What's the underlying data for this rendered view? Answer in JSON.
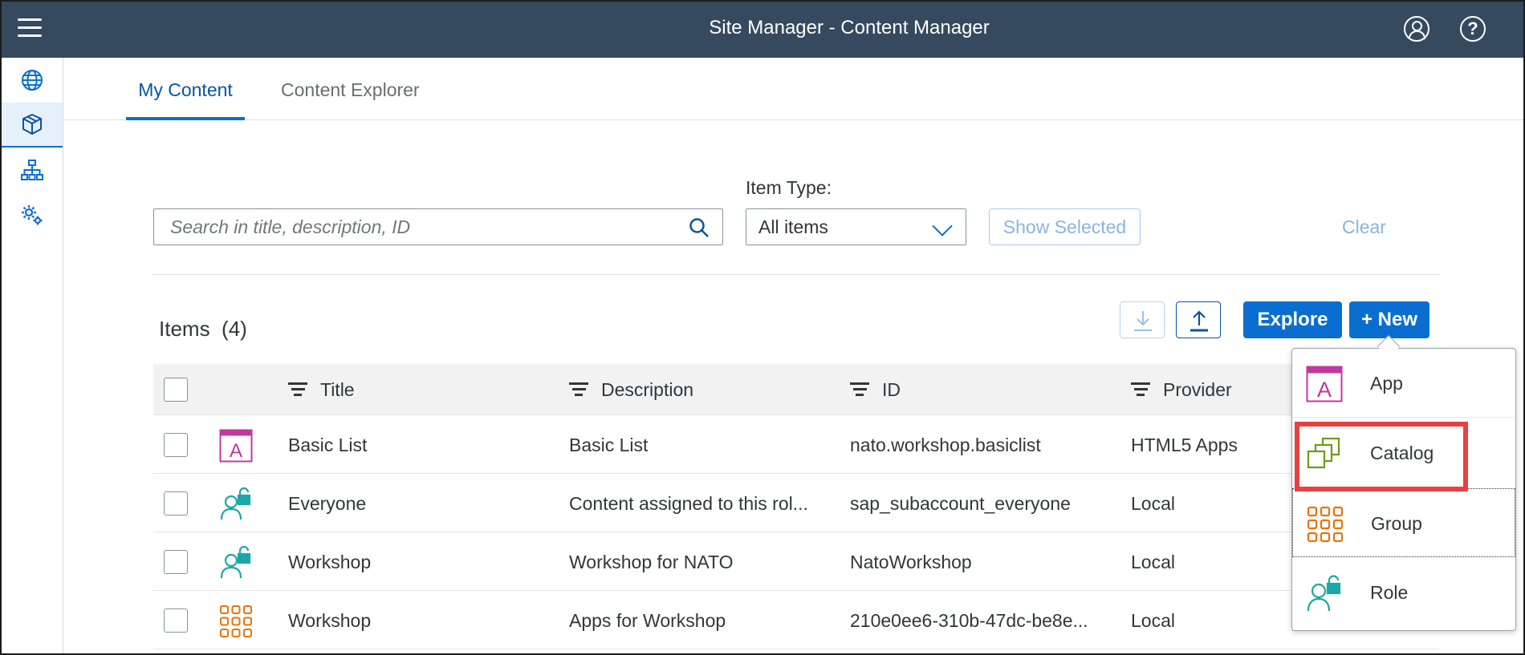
{
  "shell": {
    "title": "Site Manager - Content Manager"
  },
  "nav": {
    "items": [
      "globe-icon",
      "content-cube-icon",
      "site-hierarchy-icon",
      "settings-gear-icon"
    ],
    "active": "content-cube-icon"
  },
  "tabs": [
    {
      "label": "My Content",
      "selected": true
    },
    {
      "label": "Content Explorer",
      "selected": false
    }
  ],
  "filters": {
    "search_placeholder": "Search in title, description, ID",
    "item_type_label": "Item Type:",
    "item_type_value": "All items",
    "show_selected": "Show Selected",
    "clear": "Clear"
  },
  "items": {
    "title": "Items",
    "count": "(4)",
    "explore": "Explore",
    "new": "+ New"
  },
  "table": {
    "columns": [
      "Title",
      "Description",
      "ID",
      "Provider"
    ],
    "rows": [
      {
        "icon": "app-icon",
        "title": "Basic List",
        "description": "Basic List",
        "id": "nato.workshop.basiclist",
        "provider": "HTML5 Apps"
      },
      {
        "icon": "role-icon",
        "title": "Everyone",
        "description": "Content assigned to this rol...",
        "id": "sap_subaccount_everyone",
        "provider": "Local"
      },
      {
        "icon": "role-icon",
        "title": "Workshop",
        "description": "Workshop for NATO",
        "id": "NatoWorkshop",
        "provider": "Local"
      },
      {
        "icon": "group-icon",
        "title": "Workshop",
        "description": "Apps for Workshop",
        "id": "210e0ee6-310b-47dc-be8e...",
        "provider": "Local"
      }
    ]
  },
  "new_menu": {
    "items": [
      {
        "icon": "app-icon",
        "label": "App"
      },
      {
        "icon": "catalog-icon",
        "label": "Catalog"
      },
      {
        "icon": "group-icon",
        "label": "Group"
      },
      {
        "icon": "role-icon",
        "label": "Role"
      }
    ],
    "highlighted": "Catalog"
  },
  "colors": {
    "shell": "#354a5f",
    "accent": "#0a6ed1",
    "app_icon": "#c0399f",
    "role_icon": "#1ba7a7",
    "group_icon": "#e9730c",
    "catalog_icon": "#6f9a16",
    "highlight": "#e8413f"
  }
}
